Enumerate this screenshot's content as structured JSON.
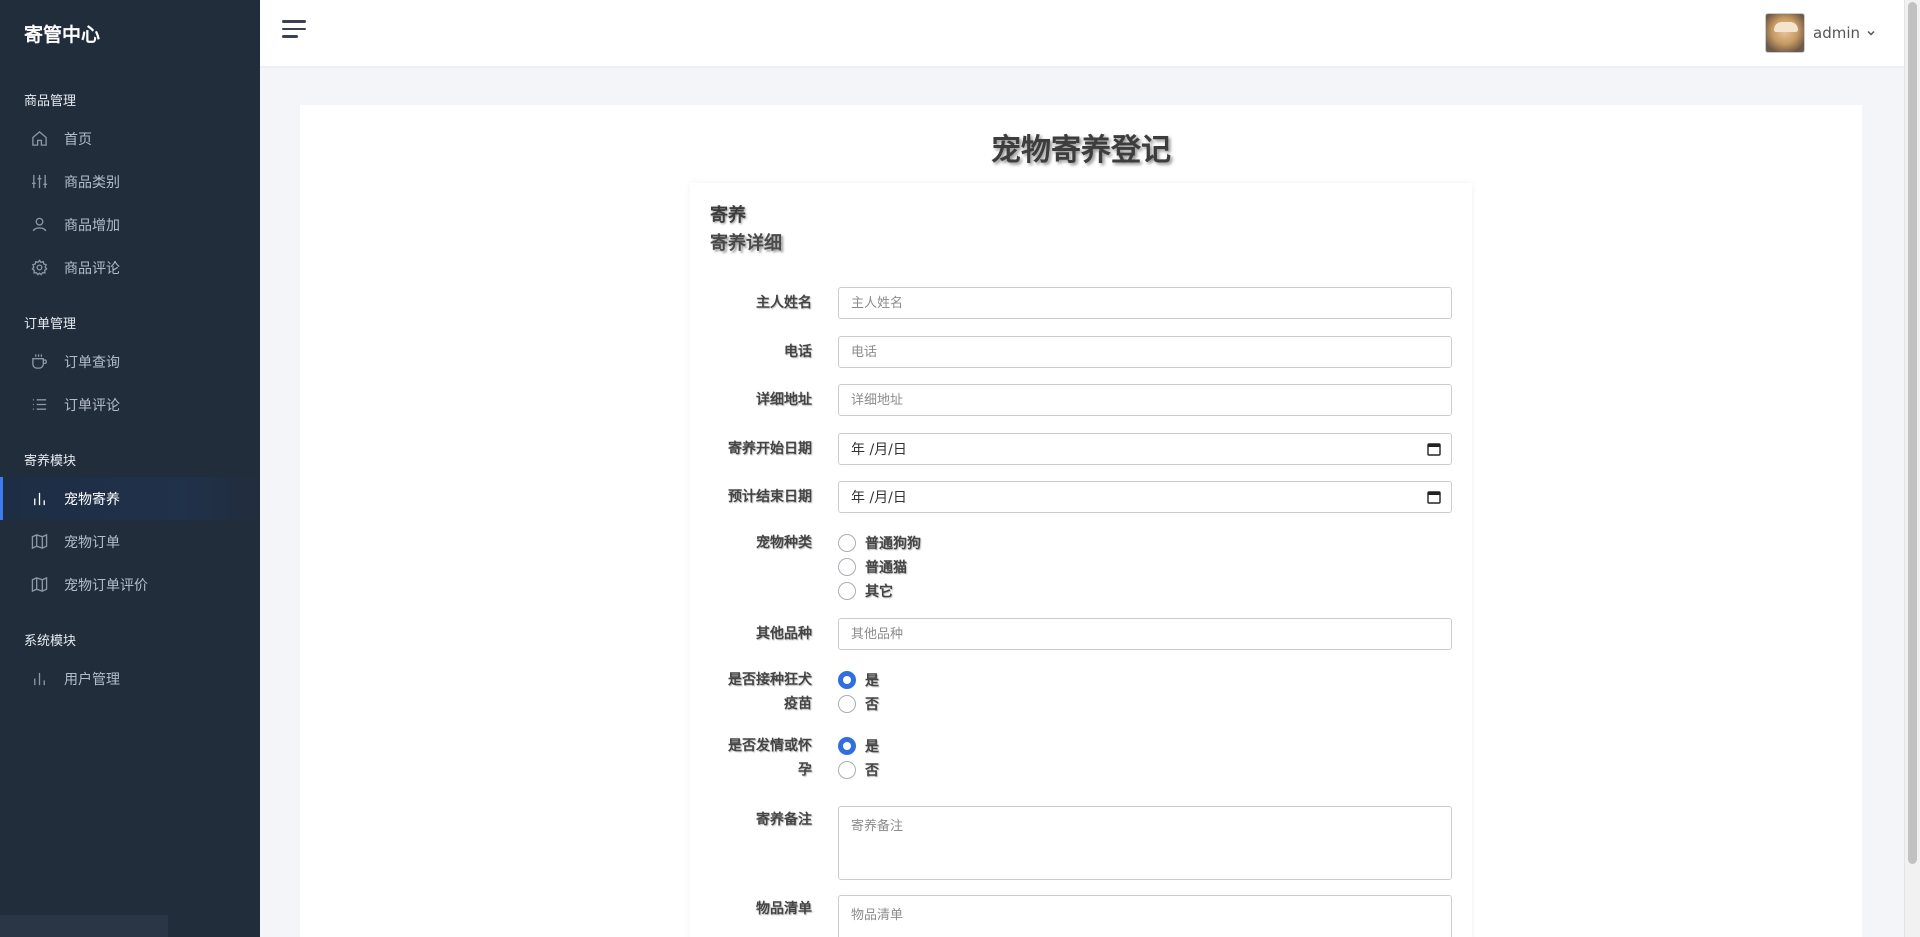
{
  "sidebar": {
    "brand": "寄管中心",
    "groups": [
      {
        "title": "商品管理",
        "items": [
          {
            "label": "首页",
            "icon": "home-icon"
          },
          {
            "label": "商品类别",
            "icon": "sliders-icon"
          },
          {
            "label": "商品增加",
            "icon": "user-icon"
          },
          {
            "label": "商品评论",
            "icon": "gear-icon"
          }
        ]
      },
      {
        "title": "订单管理",
        "items": [
          {
            "label": "订单查询",
            "icon": "cup-icon"
          },
          {
            "label": "订单评论",
            "icon": "list-icon"
          }
        ]
      },
      {
        "title": "寄养模块",
        "items": [
          {
            "label": "宠物寄养",
            "icon": "bar-chart-icon",
            "active": true
          },
          {
            "label": "宠物订单",
            "icon": "map-icon"
          },
          {
            "label": "宠物订单评价",
            "icon": "map-icon"
          }
        ]
      },
      {
        "title": "系统模块",
        "items": [
          {
            "label": "用户管理",
            "icon": "bar-chart-icon"
          }
        ]
      }
    ]
  },
  "header": {
    "user_name": "admin"
  },
  "page": {
    "title": "宠物寄养登记",
    "section_title": "寄养",
    "section_subtitle": "寄养详细"
  },
  "form": {
    "owner_name": {
      "label": "主人姓名",
      "placeholder": "主人姓名",
      "value": ""
    },
    "phone": {
      "label": "电话",
      "placeholder": "电话",
      "value": ""
    },
    "address": {
      "label": "详细地址",
      "placeholder": "详细地址",
      "value": ""
    },
    "start_date": {
      "label": "寄养开始日期",
      "display": "年 /月/日"
    },
    "end_date": {
      "label": "预计结束日期",
      "display": "年 /月/日"
    },
    "pet_type": {
      "label": "宠物种类",
      "options": [
        "普通狗狗",
        "普通猫",
        "其它"
      ],
      "selected": null
    },
    "other_breed": {
      "label": "其他品种",
      "placeholder": "其他品种",
      "value": ""
    },
    "rabies": {
      "label_line1": "是否接种狂犬",
      "label_line2": "疫苗",
      "options": [
        "是",
        "否"
      ],
      "selected": "是"
    },
    "heat": {
      "label_line1": "是否发情或怀",
      "label_line2": "孕",
      "options": [
        "是",
        "否"
      ],
      "selected": "是"
    },
    "notes": {
      "label": "寄养备注",
      "placeholder": "寄养备注",
      "value": ""
    },
    "items_list": {
      "label": "物品清单",
      "placeholder": "物品清单",
      "value": ""
    }
  },
  "colors": {
    "sidebar_bg": "#222d3c",
    "accent": "#2f6fe0",
    "page_bg": "#f4f5f9"
  }
}
